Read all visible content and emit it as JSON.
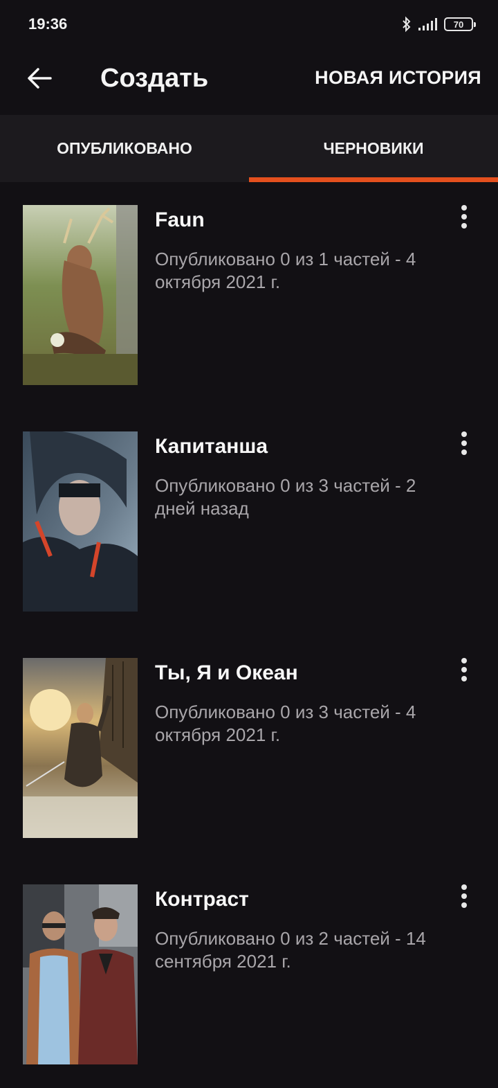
{
  "status_bar": {
    "time": "19:36",
    "icons": [
      "bluetooth-icon",
      "signal-icon",
      "battery-icon"
    ],
    "battery_level": "70"
  },
  "app_bar": {
    "back_icon": "arrow-left-icon",
    "title": "Создать",
    "new_story_label": "НОВАЯ ИСТОРИЯ"
  },
  "tabs": {
    "items": [
      {
        "label": "ОПУБЛИКОВАНО",
        "active": false
      },
      {
        "label": "ЧЕРНОВИКИ",
        "active": true
      }
    ],
    "accent_color": "#e4501e"
  },
  "stories": [
    {
      "title": "Faun",
      "meta": "Опубликовано 0 из 1 частей - 4 октября 2021 г."
    },
    {
      "title": "Капитанша",
      "meta": "Опубликовано 0 из 3 частей - 2 дней назад"
    },
    {
      "title": "Ты, Я и Океан",
      "meta": "Опубликовано 0 из 3 частей - 4 октября 2021 г."
    },
    {
      "title": "Контраст",
      "meta": "Опубликовано 0 из 2 частей - 14 сентября 2021 г."
    }
  ]
}
